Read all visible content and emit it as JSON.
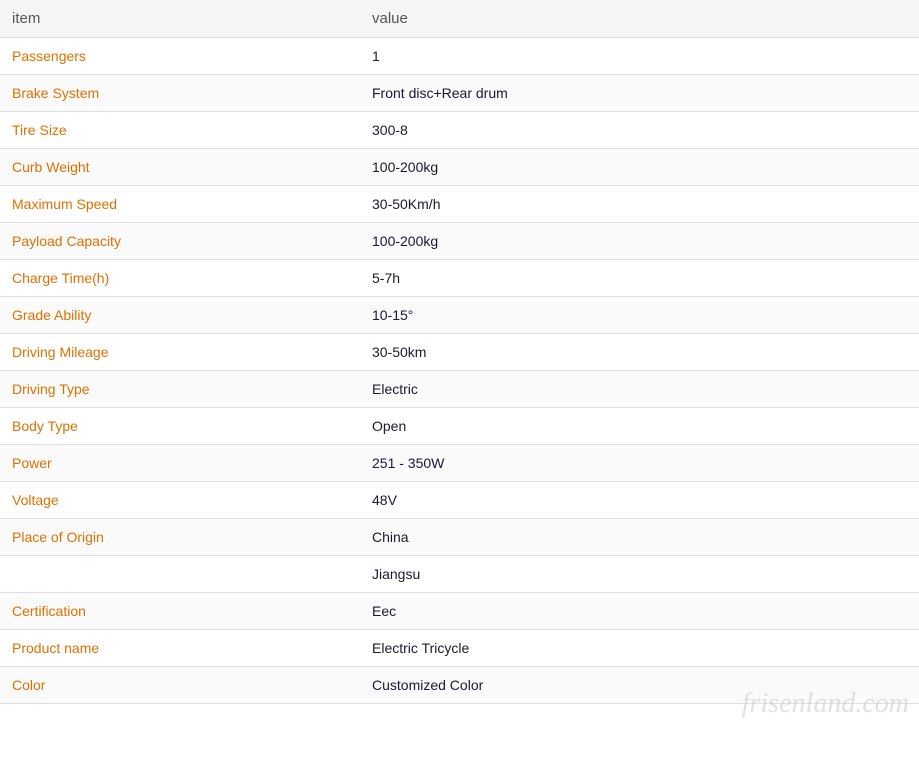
{
  "header": {
    "col1": "item",
    "col2": "value"
  },
  "rows": [
    {
      "item": "Passengers",
      "value": "1"
    },
    {
      "item": "Brake System",
      "value": "Front disc+Rear drum"
    },
    {
      "item": "Tire Size",
      "value": "300-8"
    },
    {
      "item": "Curb Weight",
      "value": "100-200kg"
    },
    {
      "item": "Maximum Speed",
      "value": "30-50Km/h"
    },
    {
      "item": "Payload Capacity",
      "value": "100-200kg"
    },
    {
      "item": "Charge Time(h)",
      "value": "5-7h"
    },
    {
      "item": "Grade Ability",
      "value": "10-15°"
    },
    {
      "item": "Driving Mileage",
      "value": "30-50km"
    },
    {
      "item": "Driving Type",
      "value": "Electric"
    },
    {
      "item": "Body Type",
      "value": "Open"
    },
    {
      "item": "Power",
      "value": "251 - 350W"
    },
    {
      "item": "Voltage",
      "value": "48V"
    },
    {
      "item": "Place of Origin",
      "value": "China"
    },
    {
      "item": "",
      "value": "Jiangsu"
    },
    {
      "item": "Certification",
      "value": "Eec"
    },
    {
      "item": "Product name",
      "value": "Electric Tricycle"
    },
    {
      "item": "Color",
      "value": "Customized Color"
    }
  ],
  "watermark": {
    "main": "frisenland.com",
    "sub": ""
  }
}
